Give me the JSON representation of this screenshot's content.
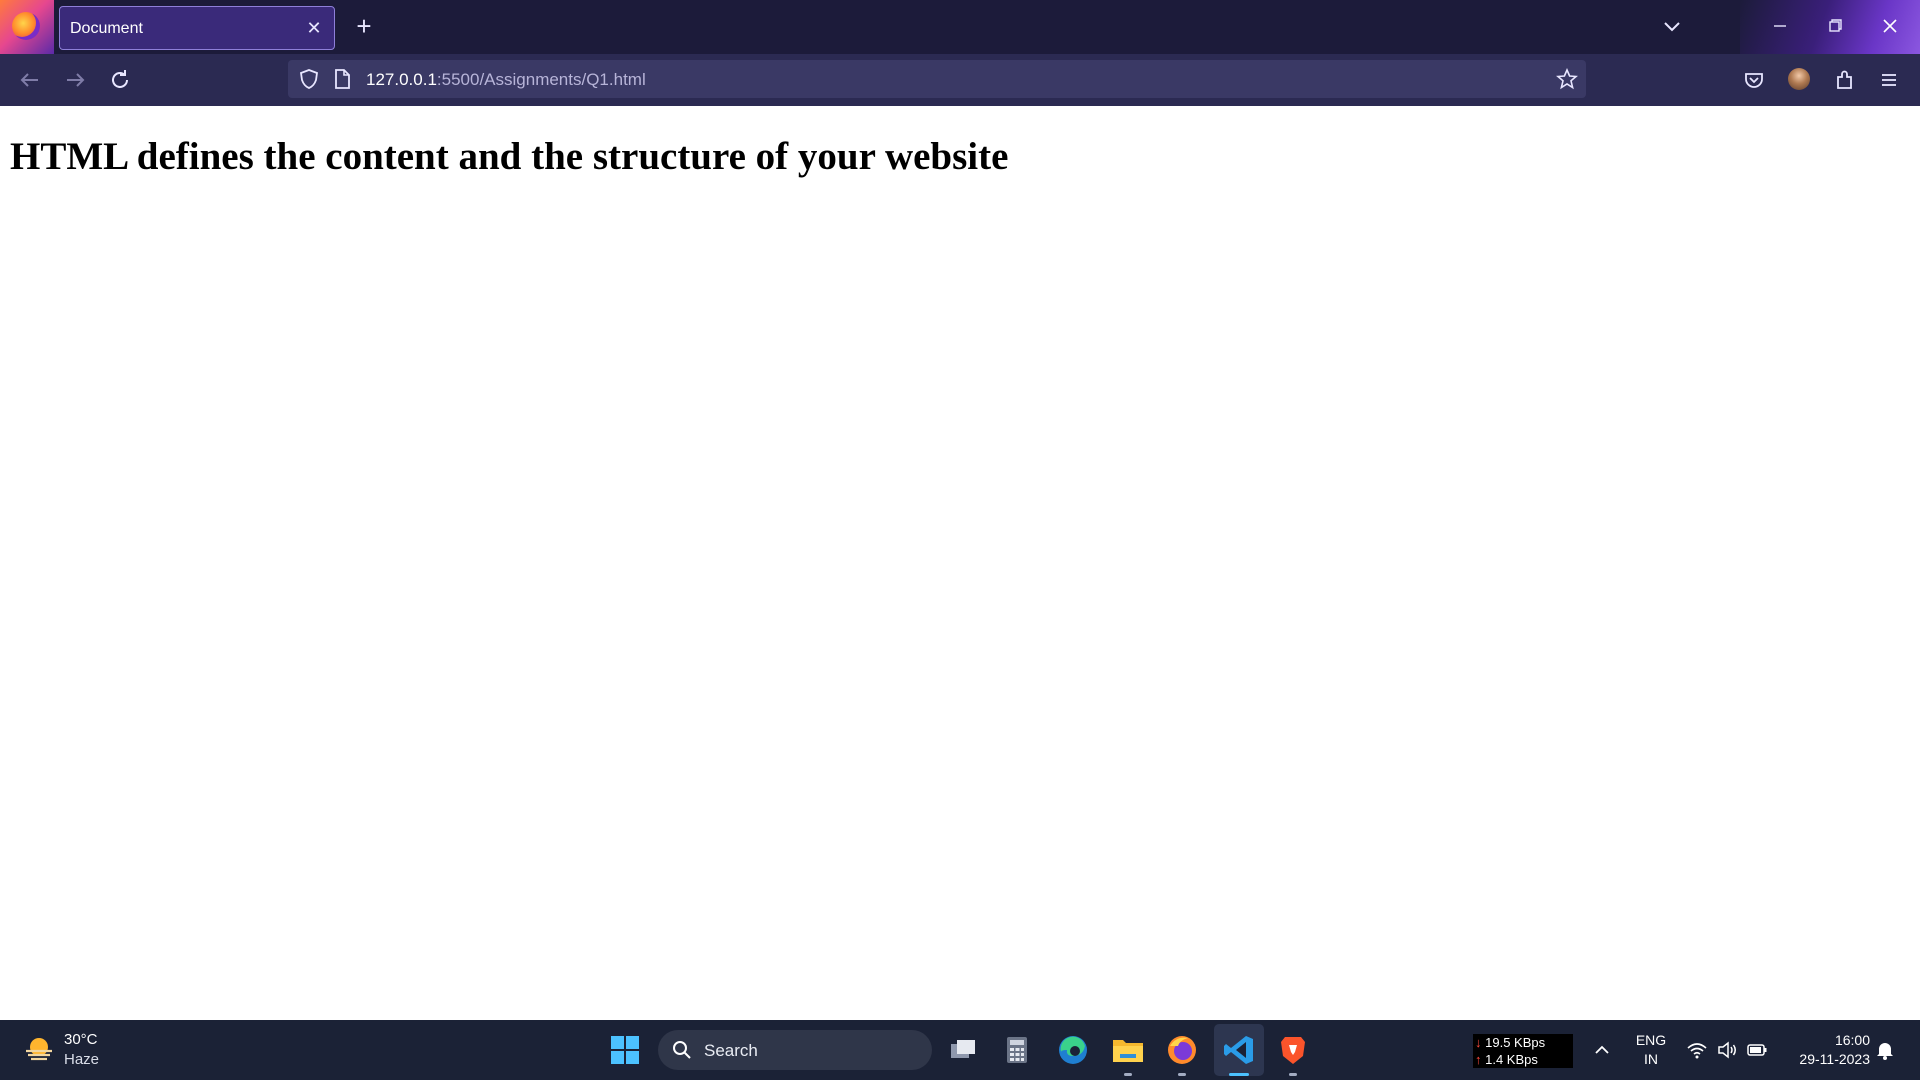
{
  "browser": {
    "tab": {
      "title": "Document",
      "close_symbol": "✕"
    },
    "new_tab_symbol": "+",
    "url": {
      "host": "127.0.0.1",
      "path": ":5500/Assignments/Q1.html"
    }
  },
  "page": {
    "heading": "HTML defines the content and the structure of your website"
  },
  "taskbar": {
    "weather": {
      "temp": "30°C",
      "desc": "Haze"
    },
    "search_label": "Search",
    "network": {
      "down": "19.5 KBps",
      "up": "1.4 KBps"
    },
    "language": {
      "lang": "ENG",
      "region": "IN"
    },
    "clock": {
      "time": "16:00",
      "date": "29-11-2023"
    },
    "apps": [
      "task-view-icon",
      "calculator-icon",
      "edge-icon",
      "file-explorer-icon",
      "firefox-icon",
      "vscode-icon",
      "brave-icon"
    ]
  },
  "colors": {
    "titlebar": "#1c1b3a",
    "navbar": "#2b2a52",
    "taskbar": "#1b2236",
    "accent": "#4cc2ff"
  }
}
